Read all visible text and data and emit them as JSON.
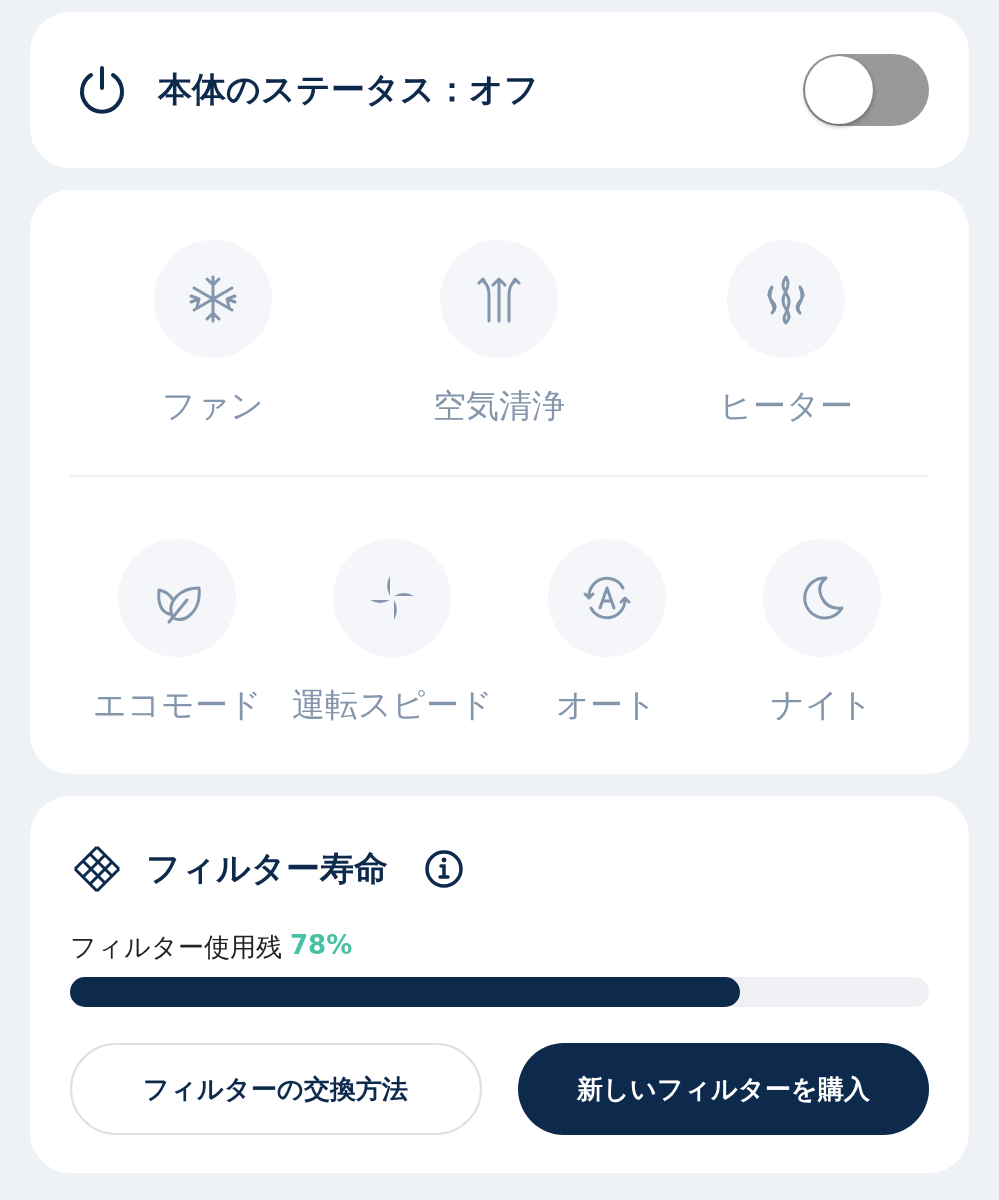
{
  "status": {
    "title": "本体のステータス：オフ",
    "on": false
  },
  "modes_top": [
    {
      "label": "ファン"
    },
    {
      "label": "空気清浄"
    },
    {
      "label": "ヒーター"
    }
  ],
  "modes_bottom": [
    {
      "label": "エコモード"
    },
    {
      "label": "運転スピード"
    },
    {
      "label": "オート"
    },
    {
      "label": "ナイト"
    }
  ],
  "filter": {
    "title": "フィルター寿命",
    "remaining_label": "フィルター使用残",
    "remaining_value": "78%",
    "level": 0.78,
    "buttons": [
      {
        "label": "フィルターの交換方法",
        "kind": "outline"
      },
      {
        "label": "新しいフィルターを購入",
        "kind": "filled"
      }
    ]
  }
}
